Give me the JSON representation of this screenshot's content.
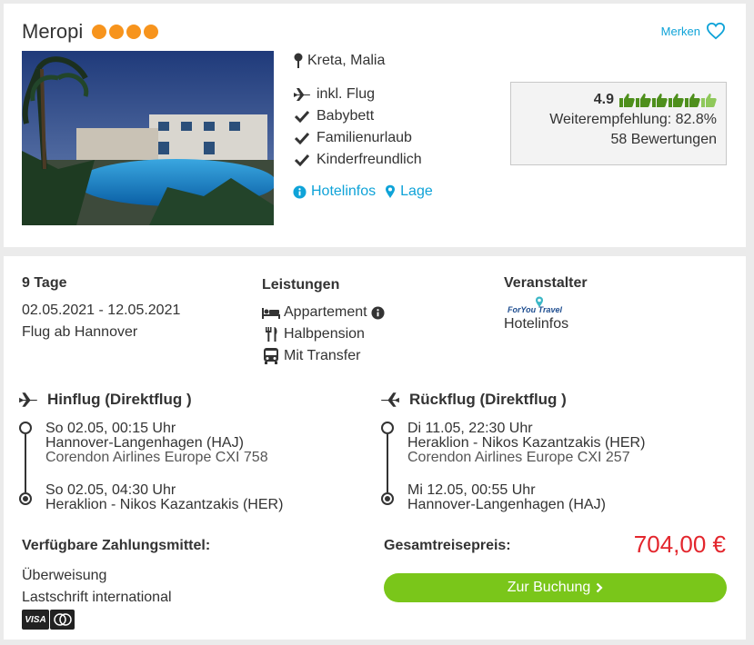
{
  "hotel": {
    "name": "Meropi",
    "star_count": 4,
    "merken_label": "Merken",
    "location": "Kreta, Malia",
    "features": [
      {
        "icon": "plane-icon",
        "label": "inkl. Flug"
      },
      {
        "icon": "check-icon",
        "label": "Babybett"
      },
      {
        "icon": "check-icon",
        "label": "Familienurlaub"
      },
      {
        "icon": "check-icon",
        "label": "Kinderfreundlich"
      }
    ],
    "links": {
      "hotelinfos": "Hotelinfos",
      "lage": "Lage"
    },
    "rating": {
      "score": "4.9",
      "thumbs": 6,
      "recommendation": "Weiterempfehlung: 82.8%",
      "reviews": "58 Bewertungen"
    }
  },
  "offer": {
    "duration": "9 Tage",
    "dates": "02.05.2021 - 12.05.2021",
    "departure": "Flug ab Hannover",
    "leistungen_title": "Leistungen",
    "leistungen": [
      {
        "icon": "bed-icon",
        "label": "Appartement"
      },
      {
        "icon": "cutlery-icon",
        "label": "Halbpension"
      },
      {
        "icon": "bus-icon",
        "label": "Mit Transfer"
      }
    ],
    "veranstalter_title": "Veranstalter",
    "veranstalter_logo_text": "ForYou Travel",
    "veranstalter_link": "Hotelinfos",
    "hinflug": {
      "title": "Hinflug (Direktflug )",
      "dep_time": "So 02.05, 00:15 Uhr",
      "dep_airport": "Hannover-Langenhagen (HAJ)",
      "airline": "Corendon Airlines Europe CXI 758",
      "arr_time": "So 02.05, 04:30 Uhr",
      "arr_airport": "Heraklion - Nikos Kazantzakis (HER)"
    },
    "rueckflug": {
      "title": "Rückflug (Direktflug )",
      "dep_time": "Di 11.05, 22:30 Uhr",
      "dep_airport": "Heraklion - Nikos Kazantzakis (HER)",
      "airline": "Corendon Airlines Europe CXI 257",
      "arr_time": "Mi 12.05, 00:55 Uhr",
      "arr_airport": "Hannover-Langenhagen (HAJ)"
    },
    "payment_title": "Verfügbare Zahlungsmittel:",
    "payment_methods": [
      "Überweisung",
      "Lastschrift international"
    ],
    "visa_label": "VISA",
    "total_label": "Gesamtreisepreis:",
    "total_price": "704,00 €",
    "book_label": "Zur Buchung"
  },
  "colors": {
    "accent_blue": "#0fa3d8",
    "star_orange": "#f7941d",
    "price_red": "#e3262d",
    "button_green": "#7ac61a",
    "thumb_green": "#4e8f1c"
  }
}
